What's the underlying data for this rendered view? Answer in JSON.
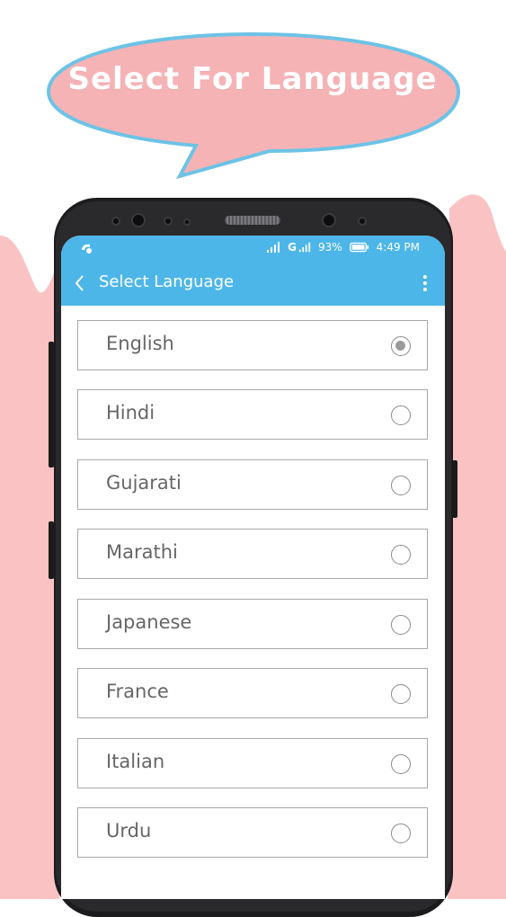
{
  "banner": {
    "title": "Select For Language"
  },
  "status_bar": {
    "battery": "93%",
    "time": "4:49 PM",
    "network": "G"
  },
  "app_bar": {
    "title": "Select Language",
    "back_icon": "chevron-left-icon",
    "menu_icon": "more-vertical-icon"
  },
  "languages": [
    {
      "label": "English",
      "selected": true
    },
    {
      "label": "Hindi",
      "selected": false
    },
    {
      "label": "Gujarati",
      "selected": false
    },
    {
      "label": "Marathi",
      "selected": false
    },
    {
      "label": "Japanese",
      "selected": false
    },
    {
      "label": "France",
      "selected": false
    },
    {
      "label": "Italian",
      "selected": false
    },
    {
      "label": "Urdu",
      "selected": false
    }
  ],
  "colors": {
    "accent": "#4db6e8",
    "bubble_fill": "#f6b3b6",
    "bubble_border": "#6cc3e6",
    "background_pink": "#fbc2c3"
  }
}
